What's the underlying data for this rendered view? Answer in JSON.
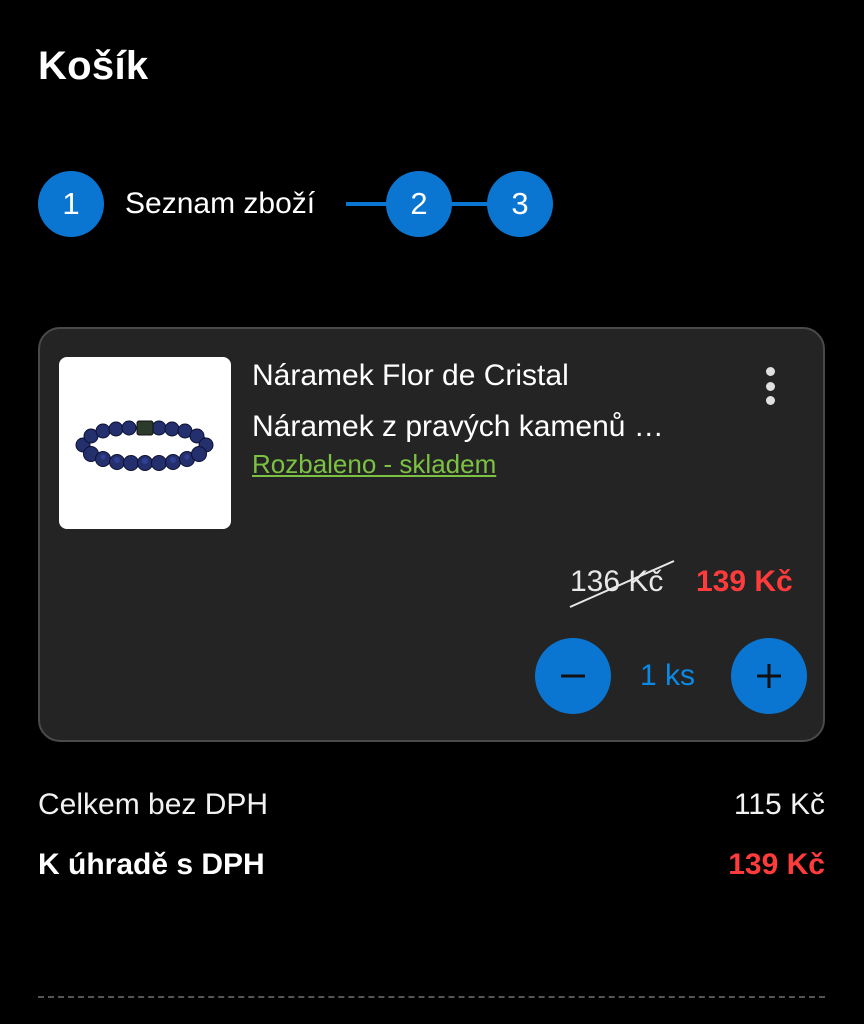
{
  "page": {
    "title": "Košík"
  },
  "stepper": {
    "step1_number": "1",
    "step1_label": "Seznam zboží",
    "step2_number": "2",
    "step3_number": "3",
    "accent_color": "#0a76d2"
  },
  "cart_item": {
    "name": "Náramek Flor de Cristal",
    "description": "Náramek z pravých kamenů …",
    "stock_status": "Rozbaleno - skladem",
    "old_price": "136 Kč",
    "new_price": "139 Kč",
    "quantity": "1 ks",
    "image_icon": "bracelet-image",
    "more_icon": "more-vertical-icon",
    "minus_icon": "minus-icon",
    "plus_icon": "plus-icon"
  },
  "totals": {
    "net_label": "Celkem bez DPH",
    "net_value": "115 Kč",
    "gross_label": "K úhradě s DPH",
    "gross_value": "139 Kč"
  },
  "colors": {
    "price_red": "#ff3b3b",
    "stock_green": "#7cc242",
    "card_bg": "#242424"
  }
}
